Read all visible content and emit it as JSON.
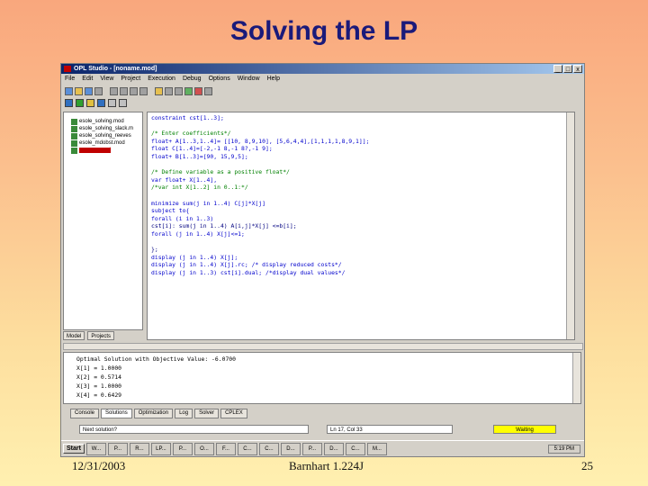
{
  "slide": {
    "title": "Solving the LP",
    "footer_date": "12/31/2003",
    "footer_author": "Barnhart 1.224J",
    "footer_page": "25"
  },
  "window": {
    "title": "OPL Studio - [noname.mod]",
    "buttons": [
      "_",
      "□",
      "x"
    ]
  },
  "menu": [
    "File",
    "Edit",
    "View",
    "Project",
    "Execution",
    "Debug",
    "Options",
    "Window",
    "Help"
  ],
  "tree": {
    "items": [
      "esole_solving.mod",
      "esole_solving_slack.m",
      "esole_solving_reeves",
      "esole_mdobst.mod",
      "noname.mod"
    ],
    "tabs": [
      "Model",
      "Projects"
    ]
  },
  "editor": {
    "lines": [
      "constraint cst[1..3];",
      "",
      "/* Enter coefficients*/",
      "float+ A[1..3,1..4]= [[10, 8,9,10], [5,6,4,4],[1,1,1,1,8,9,1]];",
      "float C[1..4]=[-2,-1 8,-1 8?,-1 9];",
      "float+ B[1..3]=[90, 15,9,5];",
      "",
      "/* Define variable as a positive float*/",
      "var float+ X[1..4],",
      "/*var int X[1..2] in 0..1:*/",
      "",
      "minimize sum(j in 1..4) C[j]*X[j]",
      "subject to{",
      "forall (i in 1..3)",
      "cst[i]: sum(j in 1..4) A[i,j]*X[j] <=b[i];",
      "forall (j in 1..4) X[j]<=1;",
      "",
      "};",
      "display (j in 1..4) X[j];",
      "display (j in 1..4) X[j].rc; /* display reduced costs*/",
      "display (j in 1..3) cst[i].dual; /*display dual values*/"
    ]
  },
  "output": {
    "lines": [
      "Optimal Solution with Objective Value: -6.0700",
      "X[1] = 1.0000",
      "X[2] = 0.5714",
      "X[3] = 1.0000",
      "X[4] = 0.6429"
    ],
    "tabs": [
      "Console",
      "Solutions",
      "Optimization",
      "Log",
      "Solver",
      "CPLEX"
    ],
    "active_tab": "Solutions"
  },
  "status": {
    "hint": "Next solution?",
    "position": "Ln 17, Col 33",
    "state": "Waiting",
    "state_color": "#ffff00"
  },
  "taskbar": {
    "start": "Start",
    "items": [
      "W...",
      "P...",
      "R...",
      "LP...",
      "P...",
      "O...",
      "F...",
      "C...",
      "C...",
      "D...",
      "P...",
      "D...",
      "C...",
      "M..."
    ],
    "clock": "5:19 PM"
  }
}
